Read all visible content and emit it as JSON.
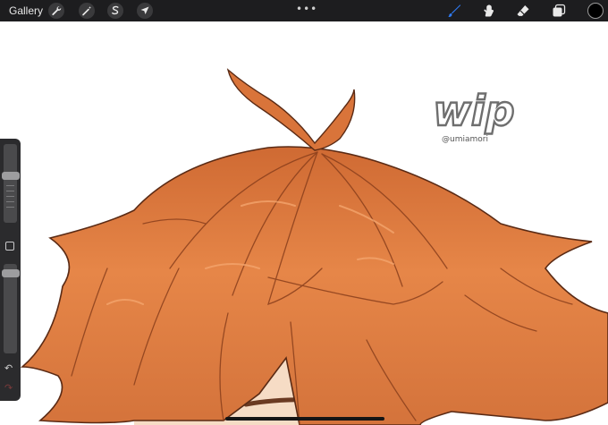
{
  "topbar": {
    "gallery_label": "Gallery",
    "dots": "•••"
  },
  "tools": [
    "wrench-icon",
    "magic-wand-icon",
    "selection-icon",
    "transform-arrow-icon"
  ],
  "right_tools": [
    "brush-icon",
    "smudge-icon",
    "eraser-icon",
    "layers-icon"
  ],
  "colors": {
    "accent": "#2f7cf6",
    "current_color": "#000000",
    "hair": "#d9743a"
  },
  "watermark": {
    "title": "wip",
    "handle": "@umiamori"
  },
  "sidebar": {
    "undo": "↶",
    "redo": "↷"
  }
}
